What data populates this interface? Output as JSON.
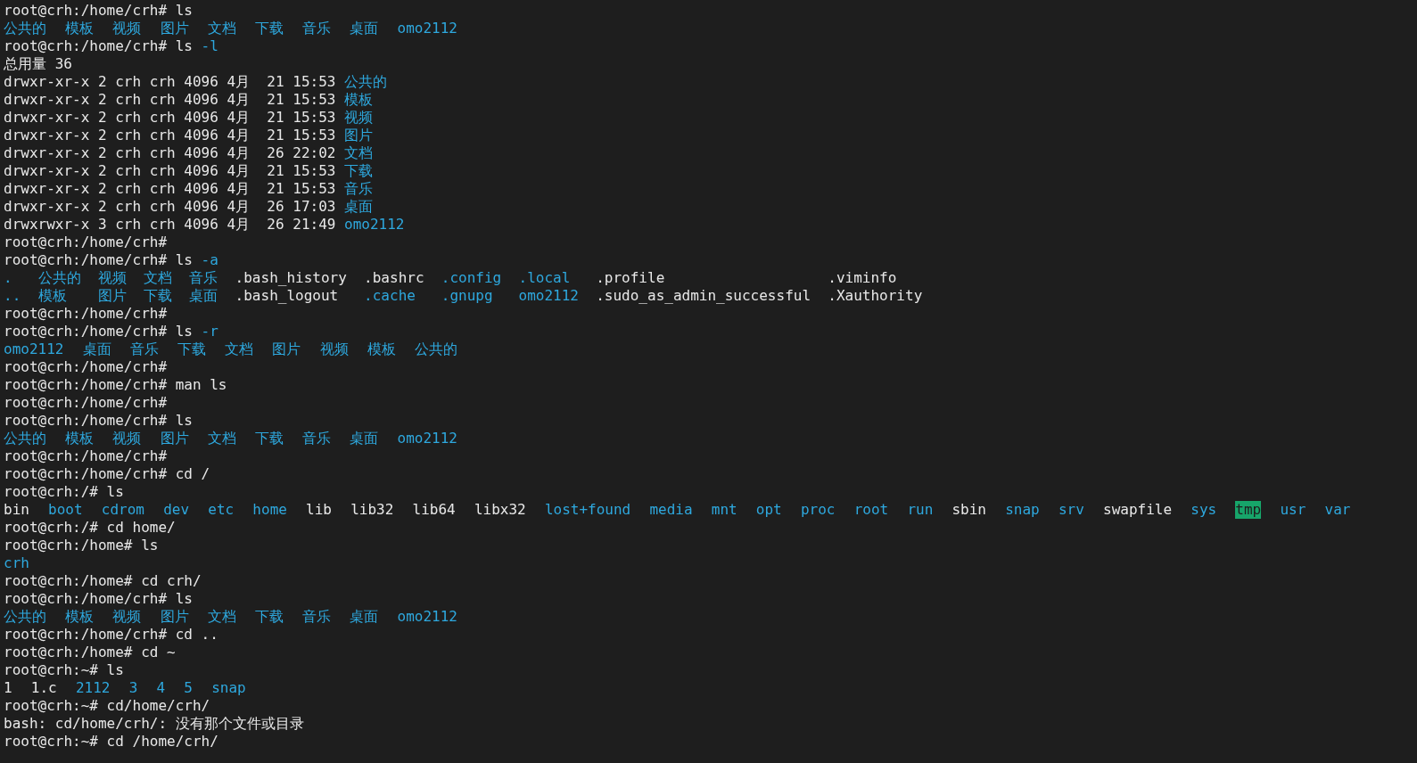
{
  "terminal": {
    "lines": [
      {
        "kind": "cmd",
        "segments": [
          {
            "kind": "plain",
            "text": "root@crh:/home/crh# ls"
          }
        ]
      },
      {
        "kind": "ls",
        "segments": [
          {
            "kind": "dir",
            "text": "公共的"
          },
          {
            "kind": "dir",
            "text": "模板"
          },
          {
            "kind": "dir",
            "text": "视频"
          },
          {
            "kind": "dir",
            "text": "图片"
          },
          {
            "kind": "dir",
            "text": "文档"
          },
          {
            "kind": "dir",
            "text": "下载"
          },
          {
            "kind": "dir",
            "text": "音乐"
          },
          {
            "kind": "dir",
            "text": "桌面"
          },
          {
            "kind": "dir",
            "text": "omo2112"
          }
        ]
      },
      {
        "kind": "cmd",
        "segments": [
          {
            "kind": "plain",
            "text": "root@crh:/home/crh# ls"
          },
          {
            "kind": "dir",
            "text": "-l"
          }
        ]
      },
      {
        "kind": "cmd",
        "segments": [
          {
            "kind": "plain",
            "text": "总用量 36"
          }
        ]
      },
      {
        "kind": "cmd",
        "segments": [
          {
            "kind": "plain",
            "text": "drwxr-xr-x 2 crh crh 4096 4月  21 15:53"
          },
          {
            "kind": "dir",
            "text": "公共的"
          }
        ]
      },
      {
        "kind": "cmd",
        "segments": [
          {
            "kind": "plain",
            "text": "drwxr-xr-x 2 crh crh 4096 4月  21 15:53"
          },
          {
            "kind": "dir",
            "text": "模板"
          }
        ]
      },
      {
        "kind": "cmd",
        "segments": [
          {
            "kind": "plain",
            "text": "drwxr-xr-x 2 crh crh 4096 4月  21 15:53"
          },
          {
            "kind": "dir",
            "text": "视频"
          }
        ]
      },
      {
        "kind": "cmd",
        "segments": [
          {
            "kind": "plain",
            "text": "drwxr-xr-x 2 crh crh 4096 4月  21 15:53"
          },
          {
            "kind": "dir",
            "text": "图片"
          }
        ]
      },
      {
        "kind": "cmd",
        "segments": [
          {
            "kind": "plain",
            "text": "drwxr-xr-x 2 crh crh 4096 4月  26 22:02"
          },
          {
            "kind": "dir",
            "text": "文档"
          }
        ]
      },
      {
        "kind": "cmd",
        "segments": [
          {
            "kind": "plain",
            "text": "drwxr-xr-x 2 crh crh 4096 4月  21 15:53"
          },
          {
            "kind": "dir",
            "text": "下载"
          }
        ]
      },
      {
        "kind": "cmd",
        "segments": [
          {
            "kind": "plain",
            "text": "drwxr-xr-x 2 crh crh 4096 4月  21 15:53"
          },
          {
            "kind": "dir",
            "text": "音乐"
          }
        ]
      },
      {
        "kind": "cmd",
        "segments": [
          {
            "kind": "plain",
            "text": "drwxr-xr-x 2 crh crh 4096 4月  26 17:03"
          },
          {
            "kind": "dir",
            "text": "桌面"
          }
        ]
      },
      {
        "kind": "cmd",
        "segments": [
          {
            "kind": "plain",
            "text": "drwxrwxr-x 3 crh crh 4096 4月  26 21:49"
          },
          {
            "kind": "dir",
            "text": "omo2112"
          }
        ]
      },
      {
        "kind": "cmd",
        "segments": [
          {
            "kind": "plain",
            "text": "root@crh:/home/crh#"
          }
        ]
      },
      {
        "kind": "cmd",
        "segments": [
          {
            "kind": "plain",
            "text": "root@crh:/home/crh# ls"
          },
          {
            "kind": "dir",
            "text": "-a"
          }
        ]
      },
      {
        "kind": "grid",
        "columns": [
          [
            {
              "kind": "dir",
              "text": "."
            },
            {
              "kind": "dir",
              "text": ".."
            }
          ],
          [
            {
              "kind": "dir",
              "text": "公共的"
            },
            {
              "kind": "dir",
              "text": "模板"
            }
          ],
          [
            {
              "kind": "dir",
              "text": "视频"
            },
            {
              "kind": "dir",
              "text": "图片"
            }
          ],
          [
            {
              "kind": "dir",
              "text": "文档"
            },
            {
              "kind": "dir",
              "text": "下载"
            }
          ],
          [
            {
              "kind": "dir",
              "text": "音乐"
            },
            {
              "kind": "dir",
              "text": "桌面"
            }
          ],
          [
            {
              "kind": "plain",
              "text": ".bash_history"
            },
            {
              "kind": "plain",
              "text": ".bash_logout"
            }
          ],
          [
            {
              "kind": "plain",
              "text": ".bashrc"
            },
            {
              "kind": "dir",
              "text": ".cache"
            }
          ],
          [
            {
              "kind": "dir",
              "text": ".config"
            },
            {
              "kind": "dir",
              "text": ".gnupg"
            }
          ],
          [
            {
              "kind": "dir",
              "text": ".local"
            },
            {
              "kind": "dir",
              "text": "omo2112"
            }
          ],
          [
            {
              "kind": "plain",
              "text": ".profile"
            },
            {
              "kind": "plain",
              "text": ".sudo_as_admin_successful"
            }
          ],
          [
            {
              "kind": "plain",
              "text": ".viminfo"
            },
            {
              "kind": "plain",
              "text": ".Xauthority"
            }
          ]
        ]
      },
      {
        "kind": "cmd",
        "segments": [
          {
            "kind": "plain",
            "text": "root@crh:/home/crh#"
          }
        ]
      },
      {
        "kind": "cmd",
        "segments": [
          {
            "kind": "plain",
            "text": "root@crh:/home/crh# ls"
          },
          {
            "kind": "dir",
            "text": "-r"
          }
        ]
      },
      {
        "kind": "ls",
        "segments": [
          {
            "kind": "dir",
            "text": "omo2112"
          },
          {
            "kind": "dir",
            "text": "桌面"
          },
          {
            "kind": "dir",
            "text": "音乐"
          },
          {
            "kind": "dir",
            "text": "下载"
          },
          {
            "kind": "dir",
            "text": "文档"
          },
          {
            "kind": "dir",
            "text": "图片"
          },
          {
            "kind": "dir",
            "text": "视频"
          },
          {
            "kind": "dir",
            "text": "模板"
          },
          {
            "kind": "dir",
            "text": "公共的"
          }
        ]
      },
      {
        "kind": "cmd",
        "segments": [
          {
            "kind": "plain",
            "text": "root@crh:/home/crh#"
          }
        ]
      },
      {
        "kind": "cmd",
        "segments": [
          {
            "kind": "plain",
            "text": "root@crh:/home/crh# man ls"
          }
        ]
      },
      {
        "kind": "cmd",
        "segments": [
          {
            "kind": "plain",
            "text": "root@crh:/home/crh#"
          }
        ]
      },
      {
        "kind": "cmd",
        "segments": [
          {
            "kind": "plain",
            "text": "root@crh:/home/crh# ls"
          }
        ]
      },
      {
        "kind": "ls",
        "segments": [
          {
            "kind": "dir",
            "text": "公共的"
          },
          {
            "kind": "dir",
            "text": "模板"
          },
          {
            "kind": "dir",
            "text": "视频"
          },
          {
            "kind": "dir",
            "text": "图片"
          },
          {
            "kind": "dir",
            "text": "文档"
          },
          {
            "kind": "dir",
            "text": "下载"
          },
          {
            "kind": "dir",
            "text": "音乐"
          },
          {
            "kind": "dir",
            "text": "桌面"
          },
          {
            "kind": "dir",
            "text": "omo2112"
          }
        ]
      },
      {
        "kind": "cmd",
        "segments": [
          {
            "kind": "plain",
            "text": "root@crh:/home/crh#"
          }
        ]
      },
      {
        "kind": "cmd",
        "segments": [
          {
            "kind": "plain",
            "text": "root@crh:/home/crh# cd /"
          }
        ]
      },
      {
        "kind": "cmd",
        "segments": [
          {
            "kind": "plain",
            "text": "root@crh:/# ls"
          }
        ]
      },
      {
        "kind": "ls",
        "segments": [
          {
            "kind": "plain",
            "text": "bin"
          },
          {
            "kind": "dir",
            "text": "boot"
          },
          {
            "kind": "dir",
            "text": "cdrom"
          },
          {
            "kind": "dir",
            "text": "dev"
          },
          {
            "kind": "dir",
            "text": "etc"
          },
          {
            "kind": "dir",
            "text": "home"
          },
          {
            "kind": "plain",
            "text": "lib"
          },
          {
            "kind": "plain",
            "text": "lib32"
          },
          {
            "kind": "plain",
            "text": "lib64"
          },
          {
            "kind": "plain",
            "text": "libx32"
          },
          {
            "kind": "dir",
            "text": "lost+found"
          },
          {
            "kind": "dir",
            "text": "media"
          },
          {
            "kind": "dir",
            "text": "mnt"
          },
          {
            "kind": "dir",
            "text": "opt"
          },
          {
            "kind": "dir",
            "text": "proc"
          },
          {
            "kind": "dir",
            "text": "root"
          },
          {
            "kind": "dir",
            "text": "run"
          },
          {
            "kind": "plain",
            "text": "sbin"
          },
          {
            "kind": "dir",
            "text": "snap"
          },
          {
            "kind": "dir",
            "text": "srv"
          },
          {
            "kind": "plain",
            "text": "swapfile"
          },
          {
            "kind": "dir",
            "text": "sys"
          },
          {
            "kind": "sticky",
            "text": "tmp"
          },
          {
            "kind": "dir",
            "text": "usr"
          },
          {
            "kind": "dir",
            "text": "var"
          }
        ]
      },
      {
        "kind": "cmd",
        "segments": [
          {
            "kind": "plain",
            "text": "root@crh:/# cd home/"
          }
        ]
      },
      {
        "kind": "cmd",
        "segments": [
          {
            "kind": "plain",
            "text": "root@crh:/home# ls"
          }
        ]
      },
      {
        "kind": "ls",
        "segments": [
          {
            "kind": "dir",
            "text": "crh"
          }
        ]
      },
      {
        "kind": "cmd",
        "segments": [
          {
            "kind": "plain",
            "text": "root@crh:/home# cd crh/"
          }
        ]
      },
      {
        "kind": "cmd",
        "segments": [
          {
            "kind": "plain",
            "text": "root@crh:/home/crh# ls"
          }
        ]
      },
      {
        "kind": "ls",
        "segments": [
          {
            "kind": "dir",
            "text": "公共的"
          },
          {
            "kind": "dir",
            "text": "模板"
          },
          {
            "kind": "dir",
            "text": "视频"
          },
          {
            "kind": "dir",
            "text": "图片"
          },
          {
            "kind": "dir",
            "text": "文档"
          },
          {
            "kind": "dir",
            "text": "下载"
          },
          {
            "kind": "dir",
            "text": "音乐"
          },
          {
            "kind": "dir",
            "text": "桌面"
          },
          {
            "kind": "dir",
            "text": "omo2112"
          }
        ]
      },
      {
        "kind": "cmd",
        "segments": [
          {
            "kind": "plain",
            "text": "root@crh:/home/crh# cd .."
          }
        ]
      },
      {
        "kind": "cmd",
        "segments": [
          {
            "kind": "plain",
            "text": "root@crh:/home# cd ~"
          }
        ]
      },
      {
        "kind": "cmd",
        "segments": [
          {
            "kind": "plain",
            "text": "root@crh:~# ls"
          }
        ]
      },
      {
        "kind": "ls",
        "segments": [
          {
            "kind": "plain",
            "text": "1"
          },
          {
            "kind": "plain",
            "text": "1.c"
          },
          {
            "kind": "dir",
            "text": "2112"
          },
          {
            "kind": "dir",
            "text": "3"
          },
          {
            "kind": "dir",
            "text": "4"
          },
          {
            "kind": "dir",
            "text": "5"
          },
          {
            "kind": "dir",
            "text": "snap"
          }
        ]
      },
      {
        "kind": "cmd",
        "segments": [
          {
            "kind": "plain",
            "text": "root@crh:~# cd/home/crh/"
          }
        ]
      },
      {
        "kind": "cmd",
        "segments": [
          {
            "kind": "plain",
            "text": "bash: cd/home/crh/: 没有那个文件或目录"
          }
        ]
      },
      {
        "kind": "cmd",
        "segments": [
          {
            "kind": "plain",
            "text": "root@crh:~# cd /home/crh/"
          }
        ]
      }
    ]
  }
}
